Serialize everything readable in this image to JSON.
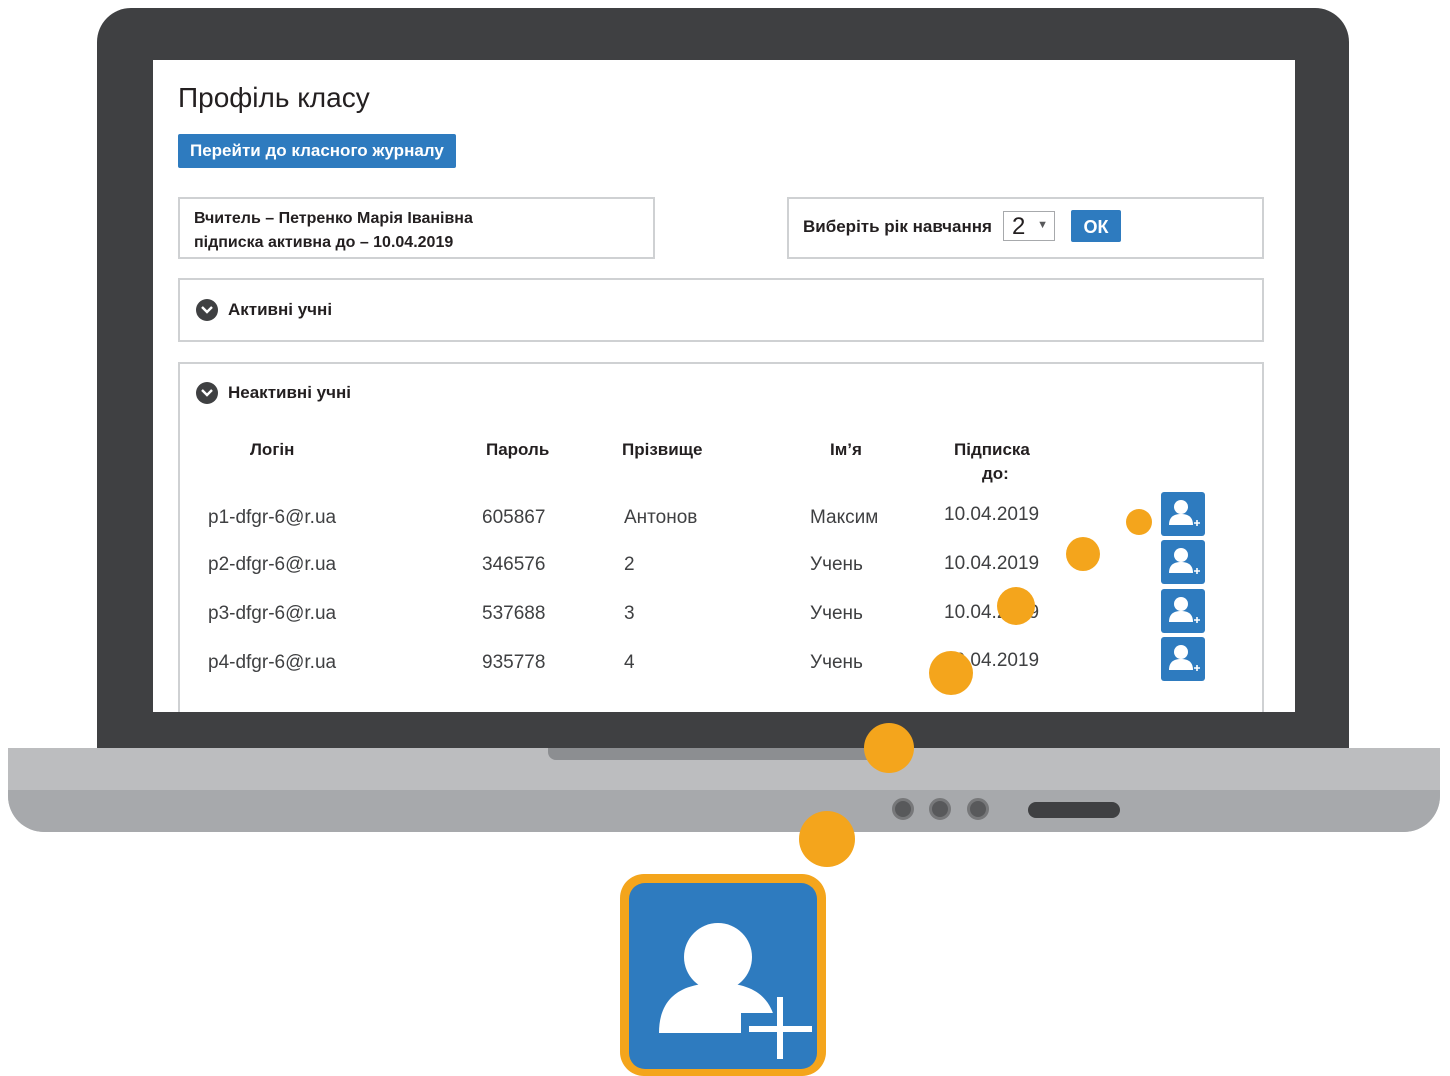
{
  "page": {
    "title": "Профіль класу",
    "journal_button": "Перейти до класного журналу"
  },
  "teacher": {
    "line1": "Вчитель – Петренко Марія Іванівна",
    "line2": "підписка активна до – 10.04.2019"
  },
  "year_selector": {
    "label": "Виберіть рік навчання",
    "value": "2",
    "ok_label": "ОК"
  },
  "sections": {
    "active": "Активні учні",
    "inactive": "Неактивні учні"
  },
  "table": {
    "columns": [
      "Логін",
      "Пароль",
      "Прізвище",
      "Ім’я",
      "Підписка",
      "до:"
    ],
    "rows": [
      {
        "login": "p1-dfgr-6@r.ua",
        "password": "605867",
        "surname": "Антонов",
        "name": "Максим",
        "until": "10.04.2019"
      },
      {
        "login": "p2-dfgr-6@r.ua",
        "password": "346576",
        "surname": "2",
        "name": "Учень",
        "until": "10.04.2019"
      },
      {
        "login": "p3-dfgr-6@r.ua",
        "password": "537688",
        "surname": "3",
        "name": "Учень",
        "until": "10.04.2019"
      },
      {
        "login": "p4-dfgr-6@r.ua",
        "password": "935778",
        "surname": "4",
        "name": "Учень",
        "until": "10.04.2019"
      }
    ]
  },
  "icons": {
    "row_action": "add-user-icon",
    "section_toggle": "chevron-down-icon",
    "highlight": "add-user-icon"
  },
  "colors": {
    "accent_blue": "#2e7bbf",
    "highlight_orange": "#f4a51c",
    "bezel": "#3f4042",
    "base": "#bcbdbf"
  }
}
